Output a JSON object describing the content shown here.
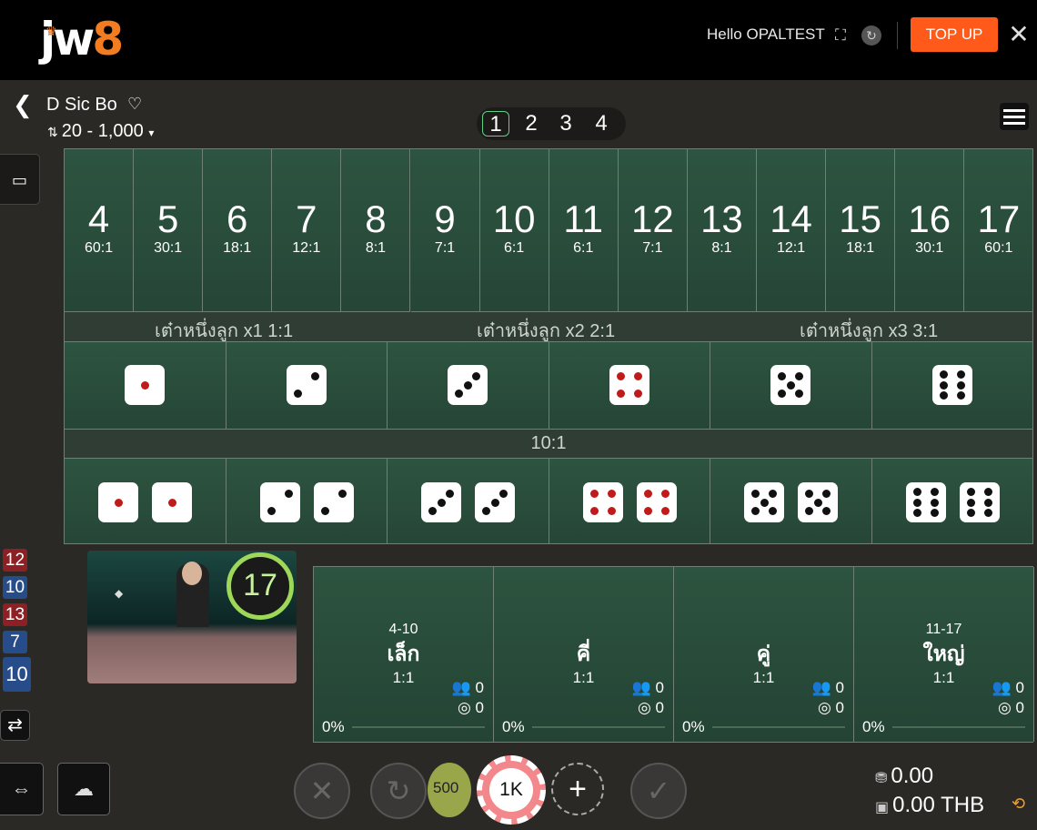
{
  "header": {
    "logo_main": "jw",
    "logo_num": "8",
    "greeting": "Hello",
    "username": "OPALTEST",
    "topup_label": "TOP UP"
  },
  "game": {
    "title": "D Sic Bo",
    "limits": "20 - 1,000",
    "tabs": [
      "1",
      "2",
      "3",
      "4"
    ],
    "active_tab": "1"
  },
  "totals": [
    {
      "num": "4",
      "pay": "60:1"
    },
    {
      "num": "5",
      "pay": "30:1"
    },
    {
      "num": "6",
      "pay": "18:1"
    },
    {
      "num": "7",
      "pay": "12:1"
    },
    {
      "num": "8",
      "pay": "8:1"
    },
    {
      "num": "9",
      "pay": "7:1"
    },
    {
      "num": "10",
      "pay": "6:1"
    },
    {
      "num": "11",
      "pay": "6:1"
    },
    {
      "num": "12",
      "pay": "7:1"
    },
    {
      "num": "13",
      "pay": "8:1"
    },
    {
      "num": "14",
      "pay": "12:1"
    },
    {
      "num": "15",
      "pay": "18:1"
    },
    {
      "num": "16",
      "pay": "30:1"
    },
    {
      "num": "17",
      "pay": "60:1"
    }
  ],
  "single_band": {
    "x1": "เต๋าหนึ่งลูก x1 1:1",
    "x2": "เต๋าหนึ่งลูก x2 2:1",
    "x3": "เต๋าหนึ่งลูก x3 3:1"
  },
  "pair_band": "10:1",
  "single_faces": [
    1,
    2,
    3,
    4,
    5,
    6
  ],
  "pair_faces": [
    1,
    2,
    3,
    4,
    5,
    6
  ],
  "history": [
    {
      "value": "12",
      "color": "red"
    },
    {
      "value": "10",
      "color": "blue"
    },
    {
      "value": "13",
      "color": "red"
    },
    {
      "value": "7",
      "color": "blue"
    },
    {
      "value": "10",
      "color": "blue"
    }
  ],
  "timer": "17",
  "outside_bets": [
    {
      "range": "4-10",
      "name": "เล็ก",
      "pay": "1:1",
      "players": "0",
      "chips": "0",
      "pct": "0%"
    },
    {
      "range": "",
      "name": "คี่",
      "pay": "1:1",
      "players": "0",
      "chips": "0",
      "pct": "0%"
    },
    {
      "range": "",
      "name": "คู่",
      "pay": "1:1",
      "players": "0",
      "chips": "0",
      "pct": "0%"
    },
    {
      "range": "11-17",
      "name": "ใหญ่",
      "pay": "1:1",
      "players": "0",
      "chips": "0",
      "pct": "0%"
    }
  ],
  "chips": {
    "left_partial": "500",
    "selected": "1K"
  },
  "balance": {
    "bet": "0.00",
    "wallet": "0.00 THB"
  },
  "colors": {
    "felt": "#2d5440",
    "topup": "#ff5a1a",
    "red_pip": "#c01a1a",
    "timer_ring": "#9ed858"
  }
}
